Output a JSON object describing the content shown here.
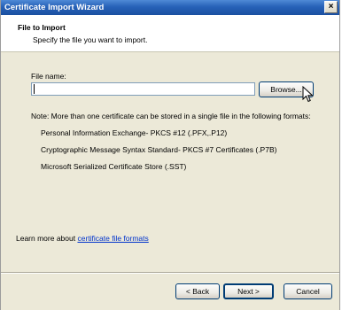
{
  "window": {
    "title": "Certificate Import Wizard",
    "close_glyph": "×"
  },
  "header": {
    "title": "File to Import",
    "subtitle": "Specify the file you want to import."
  },
  "form": {
    "file_name_label": "File name:",
    "file_name_value": "",
    "browse_label": "Browse..."
  },
  "note": {
    "text": "Note:  More than one certificate can be stored in a single file in the following formats:",
    "formats": [
      "Personal Information Exchange- PKCS #12 (.PFX,.P12)",
      "Cryptographic Message Syntax Standard- PKCS #7 Certificates (.P7B)",
      "Microsoft Serialized Certificate Store (.SST)"
    ]
  },
  "learn_more": {
    "prefix": "Learn more about ",
    "link_text": "certificate file formats"
  },
  "footer": {
    "back_label": "< Back",
    "next_label": "Next >",
    "cancel_label": "Cancel"
  },
  "icons": {
    "cursor": "mouse-pointer-icon"
  }
}
